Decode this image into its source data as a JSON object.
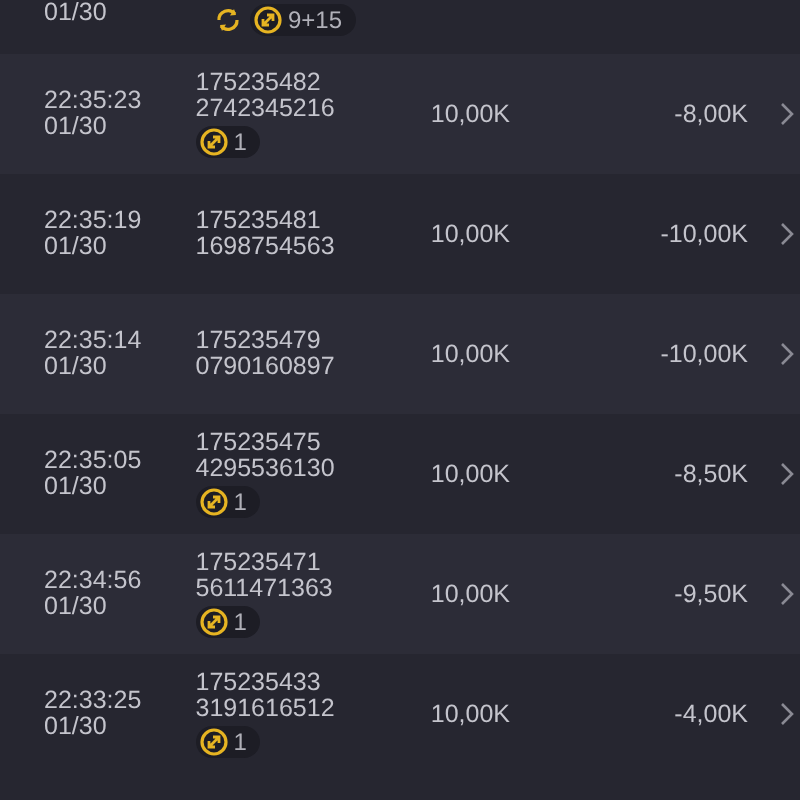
{
  "rows": [
    {
      "date": "01/30",
      "badges": [
        {
          "kind": "refresh"
        },
        {
          "kind": "count",
          "text": "9+15"
        }
      ]
    },
    {
      "time": "22:35:23",
      "date": "01/30",
      "ids": [
        "175235482",
        "2742345216"
      ],
      "stake": "10,00K",
      "result": "-8,00K",
      "badges": [
        {
          "kind": "count",
          "text": "1"
        }
      ]
    },
    {
      "time": "22:35:19",
      "date": "01/30",
      "ids": [
        "175235481",
        "1698754563"
      ],
      "stake": "10,00K",
      "result": "-10,00K",
      "badges": []
    },
    {
      "time": "22:35:14",
      "date": "01/30",
      "ids": [
        "175235479",
        "0790160897"
      ],
      "stake": "10,00K",
      "result": "-10,00K",
      "badges": []
    },
    {
      "time": "22:35:05",
      "date": "01/30",
      "ids": [
        "175235475",
        "4295536130"
      ],
      "stake": "10,00K",
      "result": "-8,50K",
      "badges": [
        {
          "kind": "count",
          "text": "1"
        }
      ]
    },
    {
      "time": "22:34:56",
      "date": "01/30",
      "ids": [
        "175235471",
        "5611471363"
      ],
      "stake": "10,00K",
      "result": "-9,50K",
      "badges": [
        {
          "kind": "count",
          "text": "1"
        }
      ]
    },
    {
      "time": "22:33:25",
      "date": "01/30",
      "ids": [
        "175235433",
        "3191616512"
      ],
      "stake": "10,00K",
      "result": "-4,00K",
      "badges": [
        {
          "kind": "count",
          "text": "1"
        }
      ]
    }
  ]
}
